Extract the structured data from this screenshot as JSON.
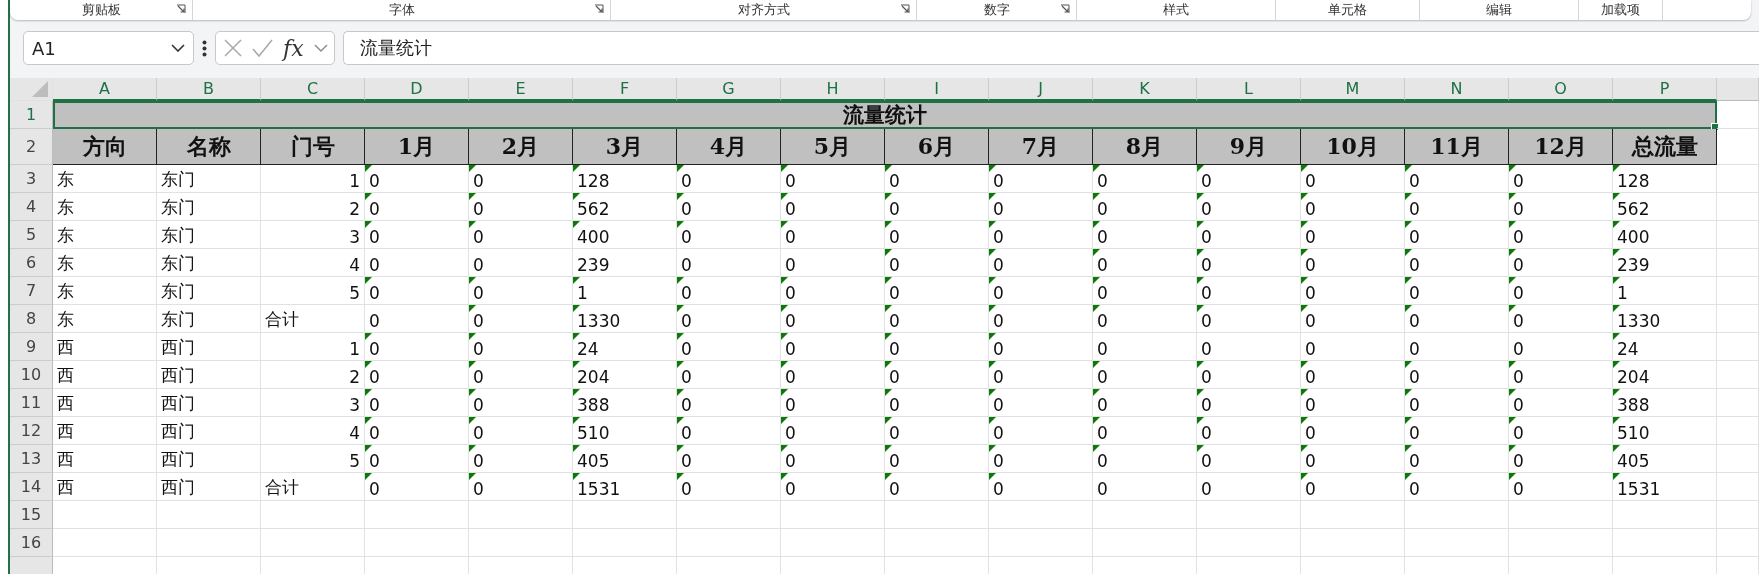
{
  "ribbon": {
    "groups": [
      {
        "label": "剪贴板",
        "launcher": true
      },
      {
        "label": "字体",
        "launcher": true
      },
      {
        "label": "对齐方式",
        "launcher": true
      },
      {
        "label": "数字",
        "launcher": true
      },
      {
        "label": "样式"
      },
      {
        "label": "单元格"
      },
      {
        "label": "编辑"
      },
      {
        "label": "加载项"
      }
    ]
  },
  "formula_bar": {
    "name_box": "A1",
    "function_label": "fx",
    "formula": "流量统计"
  },
  "sheet": {
    "columns": [
      {
        "label": "A",
        "selected": true
      },
      {
        "label": "B",
        "selected": true
      },
      {
        "label": "C",
        "selected": true
      },
      {
        "label": "D",
        "selected": true
      },
      {
        "label": "E",
        "selected": true
      },
      {
        "label": "F",
        "selected": true
      },
      {
        "label": "G",
        "selected": true
      },
      {
        "label": "H",
        "selected": true
      },
      {
        "label": "I",
        "selected": true
      },
      {
        "label": "J",
        "selected": true
      },
      {
        "label": "K",
        "selected": true
      },
      {
        "label": "L",
        "selected": true
      },
      {
        "label": "M",
        "selected": true
      },
      {
        "label": "N",
        "selected": true
      },
      {
        "label": "O",
        "selected": true
      },
      {
        "label": "P",
        "selected": true
      }
    ],
    "title_row": {
      "header": "1",
      "selected": true,
      "title": "流量统计"
    },
    "header_row": {
      "header": "2",
      "selected": false,
      "labels": [
        "方向",
        "名称",
        "门号",
        "1月",
        "2月",
        "3月",
        "4月",
        "5月",
        "6月",
        "7月",
        "8月",
        "9月",
        "10月",
        "11月",
        "12月",
        "总流量"
      ]
    },
    "rows": [
      {
        "header": "3",
        "selected": false,
        "direction": "东",
        "name": "东门",
        "door": {
          "text": "1",
          "kind": "number"
        },
        "values": [
          {
            "text": "0",
            "flagged": true
          },
          {
            "text": "0",
            "flagged": true
          },
          {
            "text": "128",
            "flagged": true
          },
          {
            "text": "0",
            "flagged": true
          },
          {
            "text": "0",
            "flagged": true
          },
          {
            "text": "0",
            "flagged": true
          },
          {
            "text": "0",
            "flagged": true
          },
          {
            "text": "0",
            "flagged": true
          },
          {
            "text": "0",
            "flagged": true
          },
          {
            "text": "0",
            "flagged": true
          },
          {
            "text": "0",
            "flagged": true
          },
          {
            "text": "0",
            "flagged": true
          },
          {
            "text": "128",
            "flagged": true
          }
        ]
      },
      {
        "header": "4",
        "selected": false,
        "direction": "东",
        "name": "东门",
        "door": {
          "text": "2",
          "kind": "number"
        },
        "values": [
          {
            "text": "0",
            "flagged": true
          },
          {
            "text": "0",
            "flagged": true
          },
          {
            "text": "562",
            "flagged": true
          },
          {
            "text": "0",
            "flagged": true
          },
          {
            "text": "0",
            "flagged": true
          },
          {
            "text": "0",
            "flagged": true
          },
          {
            "text": "0",
            "flagged": true
          },
          {
            "text": "0",
            "flagged": true
          },
          {
            "text": "0",
            "flagged": true
          },
          {
            "text": "0",
            "flagged": true
          },
          {
            "text": "0",
            "flagged": true
          },
          {
            "text": "0",
            "flagged": true
          },
          {
            "text": "562",
            "flagged": true
          }
        ]
      },
      {
        "header": "5",
        "selected": false,
        "direction": "东",
        "name": "东门",
        "door": {
          "text": "3",
          "kind": "number"
        },
        "values": [
          {
            "text": "0",
            "flagged": true
          },
          {
            "text": "0",
            "flagged": true
          },
          {
            "text": "400",
            "flagged": true
          },
          {
            "text": "0",
            "flagged": true
          },
          {
            "text": "0",
            "flagged": true
          },
          {
            "text": "0",
            "flagged": true
          },
          {
            "text": "0",
            "flagged": true
          },
          {
            "text": "0",
            "flagged": true
          },
          {
            "text": "0",
            "flagged": true
          },
          {
            "text": "0",
            "flagged": true
          },
          {
            "text": "0",
            "flagged": true
          },
          {
            "text": "0",
            "flagged": true
          },
          {
            "text": "400",
            "flagged": true
          }
        ]
      },
      {
        "header": "6",
        "selected": false,
        "direction": "东",
        "name": "东门",
        "door": {
          "text": "4",
          "kind": "number"
        },
        "values": [
          {
            "text": "0",
            "flagged": false
          },
          {
            "text": "0",
            "flagged": false
          },
          {
            "text": "239",
            "flagged": false
          },
          {
            "text": "0",
            "flagged": false
          },
          {
            "text": "0",
            "flagged": false
          },
          {
            "text": "0",
            "flagged": true
          },
          {
            "text": "0",
            "flagged": true
          },
          {
            "text": "0",
            "flagged": true
          },
          {
            "text": "0",
            "flagged": true
          },
          {
            "text": "0",
            "flagged": true
          },
          {
            "text": "0",
            "flagged": true
          },
          {
            "text": "0",
            "flagged": true
          },
          {
            "text": "239",
            "flagged": true
          }
        ]
      },
      {
        "header": "7",
        "selected": false,
        "direction": "东",
        "name": "东门",
        "door": {
          "text": "5",
          "kind": "number"
        },
        "values": [
          {
            "text": "0",
            "flagged": true
          },
          {
            "text": "0",
            "flagged": true
          },
          {
            "text": "1",
            "flagged": true
          },
          {
            "text": "0",
            "flagged": true
          },
          {
            "text": "0",
            "flagged": true
          },
          {
            "text": "0",
            "flagged": true
          },
          {
            "text": "0",
            "flagged": true
          },
          {
            "text": "0",
            "flagged": true
          },
          {
            "text": "0",
            "flagged": true
          },
          {
            "text": "0",
            "flagged": true
          },
          {
            "text": "0",
            "flagged": true
          },
          {
            "text": "0",
            "flagged": true
          },
          {
            "text": "1",
            "flagged": true
          }
        ]
      },
      {
        "header": "8",
        "selected": false,
        "direction": "东",
        "name": "东门",
        "door": {
          "text": "合计",
          "kind": "text"
        },
        "values": [
          {
            "text": "0",
            "flagged": false
          },
          {
            "text": "0",
            "flagged": true
          },
          {
            "text": "1330",
            "flagged": true
          },
          {
            "text": "0",
            "flagged": true
          },
          {
            "text": "0",
            "flagged": true
          },
          {
            "text": "0",
            "flagged": true
          },
          {
            "text": "0",
            "flagged": true
          },
          {
            "text": "0",
            "flagged": true
          },
          {
            "text": "0",
            "flagged": true
          },
          {
            "text": "0",
            "flagged": true
          },
          {
            "text": "0",
            "flagged": true
          },
          {
            "text": "0",
            "flagged": true
          },
          {
            "text": "1330",
            "flagged": true
          }
        ]
      },
      {
        "header": "9",
        "selected": false,
        "direction": "西",
        "name": "西门",
        "door": {
          "text": "1",
          "kind": "number"
        },
        "values": [
          {
            "text": "0",
            "flagged": true
          },
          {
            "text": "0",
            "flagged": true
          },
          {
            "text": "24",
            "flagged": true
          },
          {
            "text": "0",
            "flagged": true
          },
          {
            "text": "0",
            "flagged": true
          },
          {
            "text": "0",
            "flagged": true
          },
          {
            "text": "0",
            "flagged": true
          },
          {
            "text": "0",
            "flagged": false
          },
          {
            "text": "0",
            "flagged": false
          },
          {
            "text": "0",
            "flagged": false
          },
          {
            "text": "0",
            "flagged": false
          },
          {
            "text": "0",
            "flagged": false
          },
          {
            "text": "24",
            "flagged": true
          }
        ]
      },
      {
        "header": "10",
        "selected": false,
        "direction": "西",
        "name": "西门",
        "door": {
          "text": "2",
          "kind": "number"
        },
        "values": [
          {
            "text": "0",
            "flagged": true
          },
          {
            "text": "0",
            "flagged": true
          },
          {
            "text": "204",
            "flagged": true
          },
          {
            "text": "0",
            "flagged": true
          },
          {
            "text": "0",
            "flagged": true
          },
          {
            "text": "0",
            "flagged": true
          },
          {
            "text": "0",
            "flagged": true
          },
          {
            "text": "0",
            "flagged": true
          },
          {
            "text": "0",
            "flagged": true
          },
          {
            "text": "0",
            "flagged": true
          },
          {
            "text": "0",
            "flagged": true
          },
          {
            "text": "0",
            "flagged": true
          },
          {
            "text": "204",
            "flagged": true
          }
        ]
      },
      {
        "header": "11",
        "selected": false,
        "direction": "西",
        "name": "西门",
        "door": {
          "text": "3",
          "kind": "number"
        },
        "values": [
          {
            "text": "0",
            "flagged": true
          },
          {
            "text": "0",
            "flagged": true
          },
          {
            "text": "388",
            "flagged": true
          },
          {
            "text": "0",
            "flagged": true
          },
          {
            "text": "0",
            "flagged": true
          },
          {
            "text": "0",
            "flagged": true
          },
          {
            "text": "0",
            "flagged": true
          },
          {
            "text": "0",
            "flagged": true
          },
          {
            "text": "0",
            "flagged": true
          },
          {
            "text": "0",
            "flagged": true
          },
          {
            "text": "0",
            "flagged": true
          },
          {
            "text": "0",
            "flagged": true
          },
          {
            "text": "388",
            "flagged": true
          }
        ]
      },
      {
        "header": "12",
        "selected": false,
        "direction": "西",
        "name": "西门",
        "door": {
          "text": "4",
          "kind": "number"
        },
        "values": [
          {
            "text": "0",
            "flagged": true
          },
          {
            "text": "0",
            "flagged": true
          },
          {
            "text": "510",
            "flagged": true
          },
          {
            "text": "0",
            "flagged": true
          },
          {
            "text": "0",
            "flagged": true
          },
          {
            "text": "0",
            "flagged": true
          },
          {
            "text": "0",
            "flagged": true
          },
          {
            "text": "0",
            "flagged": true
          },
          {
            "text": "0",
            "flagged": true
          },
          {
            "text": "0",
            "flagged": true
          },
          {
            "text": "0",
            "flagged": true
          },
          {
            "text": "0",
            "flagged": true
          },
          {
            "text": "510",
            "flagged": true
          }
        ]
      },
      {
        "header": "13",
        "selected": false,
        "direction": "西",
        "name": "西门",
        "door": {
          "text": "5",
          "kind": "number"
        },
        "values": [
          {
            "text": "0",
            "flagged": true
          },
          {
            "text": "0",
            "flagged": true
          },
          {
            "text": "405",
            "flagged": true
          },
          {
            "text": "0",
            "flagged": true
          },
          {
            "text": "0",
            "flagged": true
          },
          {
            "text": "0",
            "flagged": true
          },
          {
            "text": "0",
            "flagged": true
          },
          {
            "text": "0",
            "flagged": true
          },
          {
            "text": "0",
            "flagged": true
          },
          {
            "text": "0",
            "flagged": true
          },
          {
            "text": "0",
            "flagged": true
          },
          {
            "text": "0",
            "flagged": true
          },
          {
            "text": "405",
            "flagged": true
          }
        ]
      },
      {
        "header": "14",
        "selected": false,
        "direction": "西",
        "name": "西门",
        "door": {
          "text": "合计",
          "kind": "text"
        },
        "values": [
          {
            "text": "0",
            "flagged": true
          },
          {
            "text": "0",
            "flagged": true
          },
          {
            "text": "1531",
            "flagged": true
          },
          {
            "text": "0",
            "flagged": true
          },
          {
            "text": "0",
            "flagged": true
          },
          {
            "text": "0",
            "flagged": true
          },
          {
            "text": "0",
            "flagged": true
          },
          {
            "text": "0",
            "flagged": false
          },
          {
            "text": "0",
            "flagged": false
          },
          {
            "text": "0",
            "flagged": true
          },
          {
            "text": "0",
            "flagged": true
          },
          {
            "text": "0",
            "flagged": true
          },
          {
            "text": "1531",
            "flagged": true
          }
        ]
      },
      {
        "header": "15",
        "selected": false
      },
      {
        "header": "16",
        "selected": false
      }
    ]
  }
}
